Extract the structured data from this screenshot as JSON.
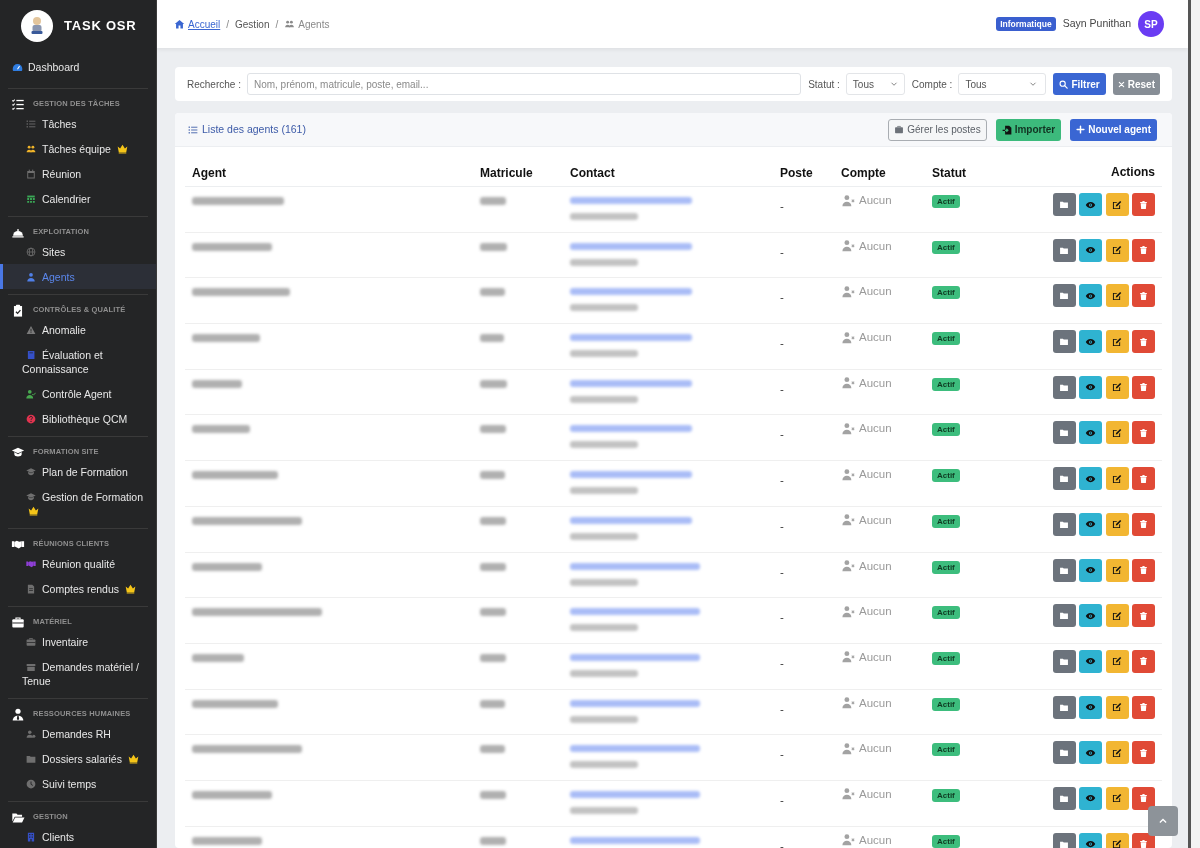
{
  "sidebar": {
    "brand": "TASK OSR",
    "groups": [
      {
        "kind": "link",
        "label": "Dashboard",
        "selected": false,
        "crown": false
      },
      {
        "kind": "section",
        "label": "GESTION DES TÂCHES",
        "children": [
          {
            "label": "Tâches",
            "selected": false,
            "crown": false
          },
          {
            "label": "Tâches équipe",
            "selected": false,
            "crown": true
          },
          {
            "label": "Réunion",
            "selected": false,
            "crown": false
          },
          {
            "label": "Calendrier",
            "selected": false,
            "crown": false
          }
        ]
      },
      {
        "kind": "section",
        "label": "EXPLOITATION",
        "children": [
          {
            "label": "Sites",
            "selected": false,
            "crown": false
          },
          {
            "label": "Agents",
            "selected": true,
            "crown": false
          }
        ]
      },
      {
        "kind": "section",
        "label": "CONTRÔLES & QUALITÉ",
        "children": [
          {
            "label": "Anomalie",
            "selected": false,
            "crown": false
          },
          {
            "label": "Évaluation et Connaissance",
            "selected": false,
            "crown": false
          },
          {
            "label": "Contrôle Agent",
            "selected": false,
            "crown": false
          },
          {
            "label": "Bibliothèque QCM",
            "selected": false,
            "crown": false
          }
        ]
      },
      {
        "kind": "section",
        "label": "FORMATION SITE",
        "children": [
          {
            "label": "Plan de Formation",
            "selected": false,
            "crown": false
          },
          {
            "label": "Gestion de Formation",
            "selected": false,
            "crown": true
          }
        ]
      },
      {
        "kind": "section",
        "label": "RÉUNIONS CLIENTS",
        "children": [
          {
            "label": "Réunion qualité",
            "selected": false,
            "crown": false
          },
          {
            "label": "Comptes rendus",
            "selected": false,
            "crown": true
          }
        ]
      },
      {
        "kind": "section",
        "label": "MATÉRIEL",
        "children": [
          {
            "label": "Inventaire",
            "selected": false,
            "crown": false
          },
          {
            "label": "Demandes matériel / Tenue",
            "selected": false,
            "crown": false
          }
        ]
      },
      {
        "kind": "section",
        "label": "RESSOURCES HUMAINES",
        "children": [
          {
            "label": "Demandes RH",
            "selected": false,
            "crown": false
          },
          {
            "label": "Dossiers salariés",
            "selected": false,
            "crown": true
          },
          {
            "label": "Suivi temps",
            "selected": false,
            "crown": false
          }
        ]
      },
      {
        "kind": "section",
        "label": "GESTION",
        "children": [
          {
            "label": "Clients",
            "selected": false,
            "crown": false
          }
        ]
      }
    ]
  },
  "breadcrumb": [
    {
      "kind": "link",
      "label": "Accueil"
    },
    {
      "kind": "separator",
      "label": "/"
    },
    {
      "kind": "text",
      "label": "Gestion"
    },
    {
      "kind": "separator",
      "label": "/"
    },
    {
      "kind": "current",
      "label": "Agents"
    }
  ],
  "user": {
    "department": "Informatique",
    "name": "Sayn Punithan",
    "initials": "SP"
  },
  "filters": {
    "search_label": "Recherche :",
    "search_placeholder": "Nom, prénom, matricule, poste, email...",
    "status_label": "Statut :",
    "status_value": "Tous",
    "account_label": "Compte :",
    "account_value": "Tous",
    "buttons": [
      {
        "kind": "filter",
        "label": "Filtrer"
      },
      {
        "kind": "reset",
        "label": "Reset"
      }
    ]
  },
  "agents_card": {
    "title": "Liste des agents (161)",
    "buttons": [
      {
        "kind": "outline",
        "label": "Gérer les postes"
      },
      {
        "kind": "import",
        "label": "Importer"
      },
      {
        "kind": "primary",
        "label": "Nouvel agent"
      }
    ]
  },
  "table": {
    "columns": [
      "Agent",
      "Matricule",
      "Contact",
      "Poste",
      "Compte",
      "Statut",
      "Actions"
    ],
    "rows": [
      {
        "poste": "-",
        "compte": "Aucun",
        "statut": "Actif"
      },
      {
        "poste": "-",
        "compte": "Aucun",
        "statut": "Actif"
      },
      {
        "poste": "-",
        "compte": "Aucun",
        "statut": "Actif"
      },
      {
        "poste": "-",
        "compte": "Aucun",
        "statut": "Actif"
      },
      {
        "poste": "-",
        "compte": "Aucun",
        "statut": "Actif"
      },
      {
        "poste": "-",
        "compte": "Aucun",
        "statut": "Actif"
      },
      {
        "poste": "-",
        "compte": "Aucun",
        "statut": "Actif"
      },
      {
        "poste": "-",
        "compte": "Aucun",
        "statut": "Actif"
      },
      {
        "poste": "-",
        "compte": "Aucun",
        "statut": "Actif"
      },
      {
        "poste": "-",
        "compte": "Aucun",
        "statut": "Actif"
      },
      {
        "poste": "-",
        "compte": "Aucun",
        "statut": "Actif"
      },
      {
        "poste": "-",
        "compte": "Aucun",
        "statut": "Actif"
      },
      {
        "poste": "-",
        "compte": "Aucun",
        "statut": "Actif"
      },
      {
        "poste": "-",
        "compte": "Aucun",
        "statut": "Actif"
      },
      {
        "poste": "-",
        "compte": "Aucun",
        "statut": "Actif"
      }
    ]
  }
}
